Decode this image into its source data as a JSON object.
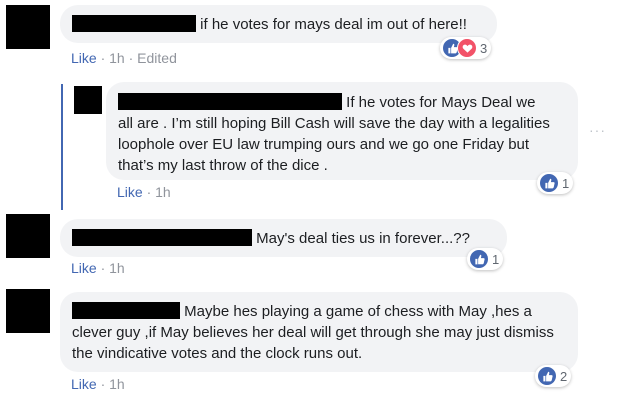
{
  "comments": [
    {
      "text": "if he votes for mays deal im out of here!!",
      "meta": {
        "like": "Like",
        "sep": " · ",
        "time": "1h",
        "sep2": " · ",
        "edited": "Edited"
      },
      "reaction_count": "3"
    },
    {
      "text_line1": "If he votes for Mays Deal we",
      "text_rest": "all are . I’m still hoping Bill Cash will save the day with a legalities loophole over EU law trumping ours and we go one Friday but that’s my last throw of the dice .",
      "meta": {
        "like": "Like",
        "sep": " · ",
        "time": "1h"
      },
      "reaction_count": "1"
    },
    {
      "text": "May's deal ties us in forever...??",
      "meta": {
        "like": "Like",
        "sep": " · ",
        "time": "1h"
      },
      "reaction_count": "1"
    },
    {
      "text_line1": "Maybe hes playing a game of chess with May ,hes a",
      "text_rest": "clever guy ,if May believes her deal will get through she may just dismiss the vindicative votes and the clock runs out.",
      "meta": {
        "like": "Like",
        "sep": " · ",
        "time": "1h"
      },
      "reaction_count": "2"
    }
  ],
  "more_menu": "···",
  "colors": {
    "like_blue": "#4267b2",
    "love_red": "#f25268",
    "bubble_bg": "#f2f3f5"
  },
  "icons": {
    "like": "thumbs-up-icon",
    "love": "heart-icon",
    "more": "more-options-icon"
  }
}
